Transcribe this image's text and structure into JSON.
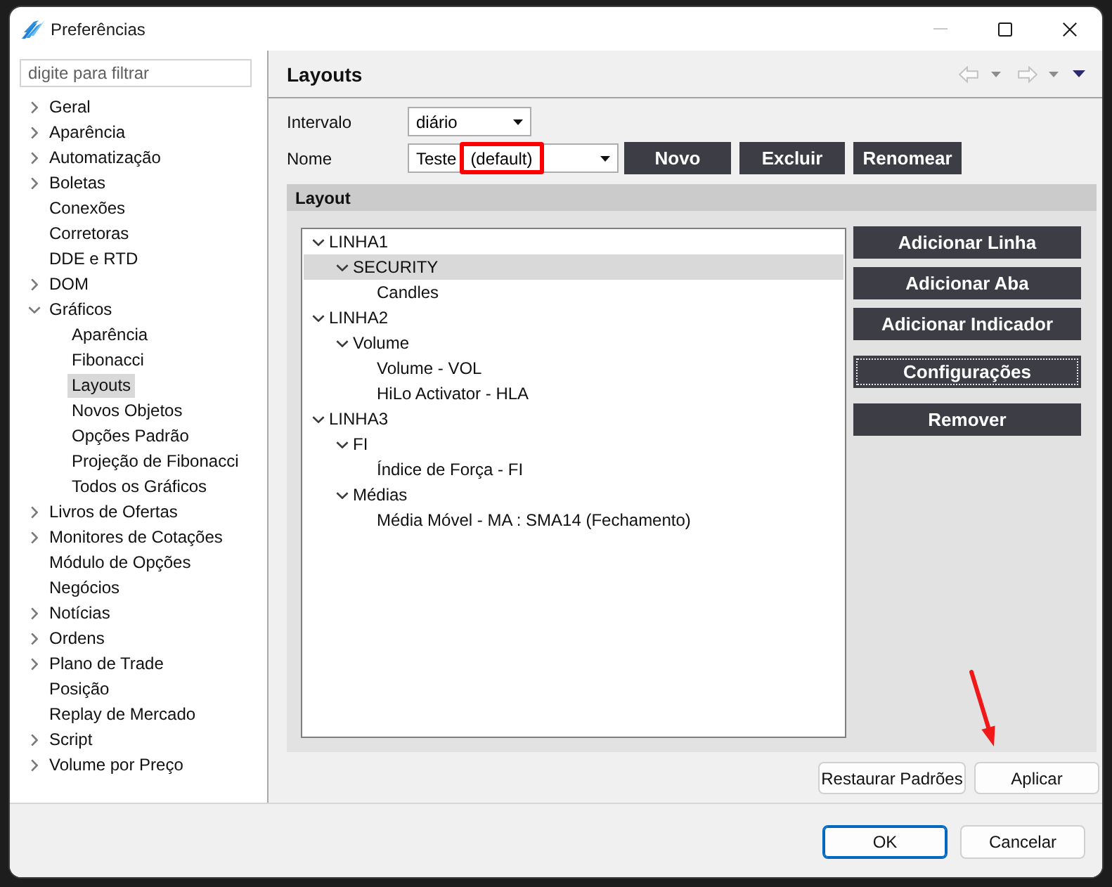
{
  "window": {
    "title": "Preferências",
    "minimize_enabled": false
  },
  "sidebar": {
    "filter": {
      "placeholder": "digite para filtrar"
    },
    "items": [
      {
        "label": "Geral",
        "expanded": false,
        "selected": false
      },
      {
        "label": "Aparência",
        "expanded": false,
        "selected": false
      },
      {
        "label": "Automatização",
        "expanded": false,
        "selected": false
      },
      {
        "label": "Boletas",
        "expanded": false,
        "selected": false
      },
      {
        "label": "Conexões",
        "selected": false
      },
      {
        "label": "Corretoras",
        "selected": false
      },
      {
        "label": "DDE e RTD",
        "selected": false
      },
      {
        "label": "DOM",
        "expanded": false,
        "selected": false
      },
      {
        "label": "Gráficos",
        "expanded": true,
        "selected": false,
        "children": [
          {
            "label": "Aparência",
            "selected": false
          },
          {
            "label": "Fibonacci",
            "selected": false
          },
          {
            "label": "Layouts",
            "selected": true
          },
          {
            "label": "Novos Objetos",
            "selected": false
          },
          {
            "label": "Opções Padrão",
            "selected": false
          },
          {
            "label": "Projeção de Fibonacci",
            "selected": false
          },
          {
            "label": "Todos os Gráficos",
            "selected": false
          }
        ]
      },
      {
        "label": "Livros de Ofertas",
        "expanded": false,
        "selected": false
      },
      {
        "label": "Monitores de Cotações",
        "expanded": false,
        "selected": false
      },
      {
        "label": "Módulo de Opções",
        "selected": false
      },
      {
        "label": "Negócios",
        "selected": false
      },
      {
        "label": "Notícias",
        "expanded": false,
        "selected": false
      },
      {
        "label": "Ordens",
        "expanded": false,
        "selected": false
      },
      {
        "label": "Plano de Trade",
        "expanded": false,
        "selected": false
      },
      {
        "label": "Posição",
        "selected": false
      },
      {
        "label": "Replay de Mercado",
        "selected": false
      },
      {
        "label": "Script",
        "expanded": false,
        "selected": false
      },
      {
        "label": "Volume por Preço",
        "expanded": false,
        "selected": false
      }
    ]
  },
  "page": {
    "title": "Layouts",
    "nav": {
      "back_enabled": false,
      "forward_enabled": false
    },
    "fields": [
      {
        "label": "Intervalo",
        "value": "diário"
      },
      {
        "label": "Nome",
        "value": "Teste",
        "suffix": "(default)",
        "suffix_highlighted": true,
        "buttons": [
          "Novo",
          "Excluir",
          "Renomear"
        ]
      }
    ],
    "layout": {
      "title": "Layout",
      "tree": [
        {
          "label": "LINHA1",
          "expanded": true,
          "selected": false,
          "children": [
            {
              "label": "SECURITY",
              "expanded": true,
              "selected": true,
              "children": [
                {
                  "label": "Candles",
                  "selected": false
                }
              ]
            }
          ]
        },
        {
          "label": "LINHA2",
          "expanded": true,
          "selected": false,
          "children": [
            {
              "label": "Volume",
              "expanded": true,
              "selected": false,
              "children": [
                {
                  "label": "Volume - VOL",
                  "selected": false
                },
                {
                  "label": "HiLo Activator - HLA",
                  "selected": false
                }
              ]
            }
          ]
        },
        {
          "label": "LINHA3",
          "expanded": true,
          "selected": false,
          "children": [
            {
              "label": "FI",
              "expanded": true,
              "selected": false,
              "children": [
                {
                  "label": "Índice de Força - FI",
                  "selected": false
                }
              ]
            },
            {
              "label": "Médias",
              "expanded": true,
              "selected": false,
              "children": [
                {
                  "label": "Média Móvel - MA : SMA14 (Fechamento)",
                  "selected": false
                }
              ]
            }
          ]
        }
      ],
      "buttons": [
        {
          "label": "Adicionar Linha",
          "focused": false
        },
        {
          "label": "Adicionar Aba",
          "focused": false
        },
        {
          "label": "Adicionar Indicador",
          "focused": false
        },
        {
          "label": "Configurações",
          "focused": true
        },
        {
          "label": "Remover",
          "focused": false
        }
      ]
    },
    "actions": [
      {
        "label": "Restaurar Padrões",
        "pointed_at": false
      },
      {
        "label": "Aplicar",
        "pointed_at": true
      }
    ]
  },
  "footer": {
    "buttons": [
      {
        "label": "OK",
        "default": true
      },
      {
        "label": "Cancelar",
        "default": false
      }
    ]
  }
}
